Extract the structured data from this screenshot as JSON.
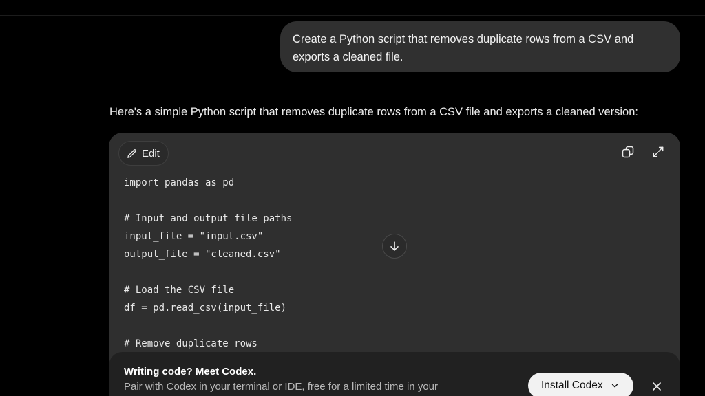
{
  "user_message": {
    "line1": "Create a Python script that removes duplicate rows from a CSV and",
    "line2": "exports a cleaned file."
  },
  "assistant": {
    "intro": "Here's a simple Python script that removes duplicate rows from a CSV file and exports a cleaned version:"
  },
  "code_card": {
    "edit_label": "Edit",
    "copy_icon": "copy-icon",
    "expand_icon": "expand-icon",
    "lines": [
      "import pandas as pd",
      "",
      "# Input and output file paths",
      "input_file = \"input.csv\"",
      "output_file = \"cleaned.csv\"",
      "",
      "# Load the CSV file",
      "df = pd.read_csv(input_file)",
      "",
      "# Remove duplicate rows"
    ]
  },
  "scroll_down_icon": "arrow-down-icon",
  "codex_banner": {
    "title": "Writing code? Meet Codex.",
    "text": "Pair with Codex in your terminal or IDE, free for a limited time in your",
    "install_label": "Install Codex"
  }
}
